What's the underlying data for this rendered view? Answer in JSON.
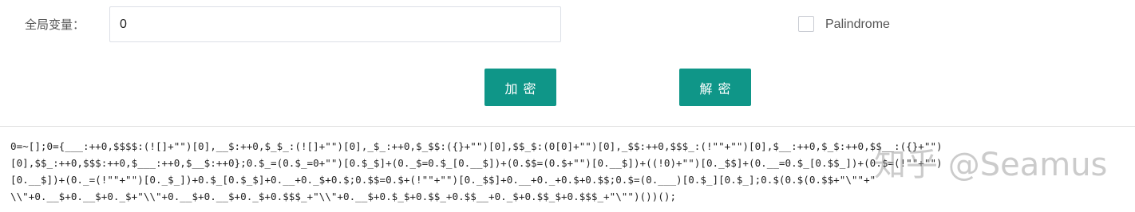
{
  "form": {
    "var_label": "全局变量：",
    "var_value": "0",
    "palindrome_label": "Palindrome",
    "palindrome_checked": false
  },
  "buttons": {
    "encrypt_label": "加密",
    "decrypt_label": "解密",
    "color": "#0f9688"
  },
  "output": {
    "lines": [
      "0=~[];0={___:++0,$$$$:(![]+\"\")[0],__$:++0,$_$_:(![]+\"\")[0],_$_:++0,$_$$:({}+\"\")[0],$$_$:(0[0]+\"\")[0],_$$:++0,$$$_:(!\"\"+\"\")[0],$__:++0,$_$:++0,$$__:({}+\"\")",
      "[0],$$_:++0,$$$:++0,$___:++0,$__$:++0};0.$_=(0.$_=0+\"\")[0.$_$]+(0._$=0.$_[0.__$])+(0.$$=(0.$+\"\")[0.__$])+((!0)+\"\")[0._$$]+(0.__=0.$_[0.$$_])+(0.$=(!\"\"+\"\")",
      "[0.__$])+(0._=(!\"\"+\"\")[0._$_])+0.$_[0.$_$]+0.__+0._$+0.$;0.$$=0.$+(!\"\"+\"\")[0._$$]+0.__+0._+0.$+0.$$;0.$=(0.___)[0.$_][0.$_];0.$(0.$(0.$$+\"\\\"\"+\"",
      "\\\\\"+0.__$+0.__$+0._$+\"\\\\\"+0.__$+0.__$+0._$+0.$$$_+\"\\\\\"+0.__$+0.$_$+0.$$_+0.$$__+0._$+0.$$_$+0.$$$_+\"\\\"\")())();"
    ]
  },
  "watermark": {
    "text": "知乎 @Seamus"
  }
}
